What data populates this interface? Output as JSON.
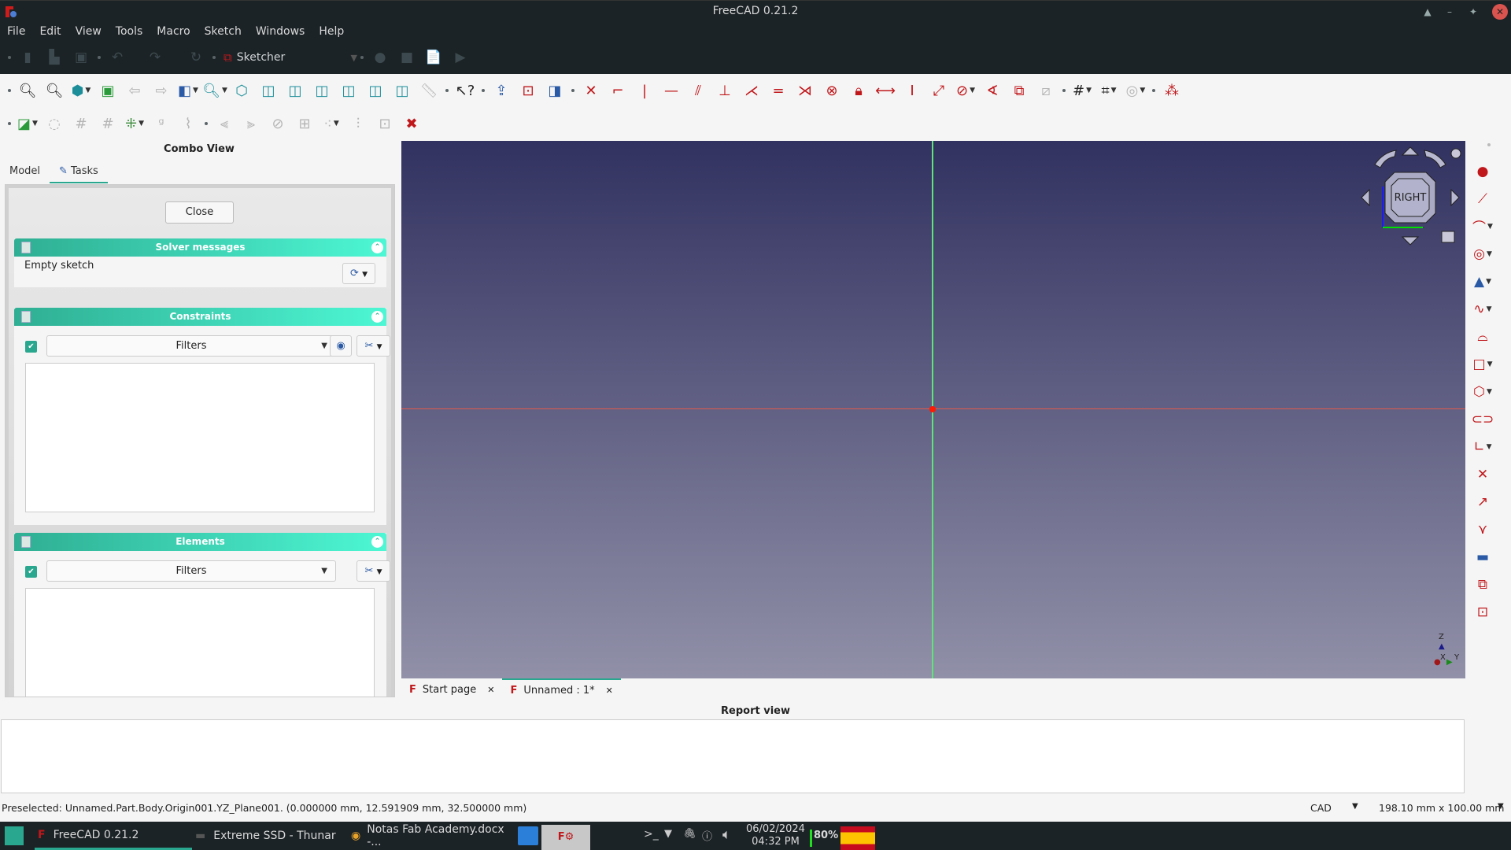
{
  "window": {
    "title": "FreeCAD 0.21.2",
    "controls": [
      "keep-above",
      "minimize",
      "maximize",
      "close"
    ]
  },
  "menu": [
    "File",
    "Edit",
    "View",
    "Tools",
    "Macro",
    "Sketch",
    "Windows",
    "Help"
  ],
  "workbench": {
    "selected": "Sketcher"
  },
  "toolbar_top": [
    "new-file",
    "open-file",
    "save",
    "undo",
    "redo",
    "refresh",
    "workbench-selector",
    "macro-record",
    "macro-stop",
    "macro-edit",
    "macro-run"
  ],
  "toolbar_view": [
    "std-view-fit-all",
    "std-view-fit-selection",
    "draw-style",
    "bounding-box",
    "back",
    "forward",
    "send-to-python",
    "zoom",
    "isometric",
    "front",
    "top",
    "right",
    "rear",
    "bottom",
    "left",
    "measure",
    "whats-this",
    "leave-sketch",
    "view-sketch",
    "view-section",
    "constrain-coincident",
    "constrain-point-on-object",
    "constrain-vertical",
    "constrain-horizontal",
    "constrain-parallel",
    "constrain-perpendicular",
    "constrain-tangent",
    "constrain-equal",
    "constrain-symmetric",
    "constrain-block",
    "constrain-lock",
    "constrain-horizontal-distance",
    "constrain-vertical-distance",
    "constrain-distance",
    "constrain-radius",
    "constrain-angle",
    "toggle-driving",
    "toggle-active",
    "grid",
    "snap",
    "rendering-order",
    "show-hide-internal-geometry"
  ],
  "toolbar_sketch": [
    "sketch-geometry",
    "close-shape",
    "connect",
    "select-constraints",
    "select-origin",
    "select-h-axis",
    "select-v-axis",
    "select-elements",
    "select-redundant",
    "select-conflicting",
    "symmetry",
    "clone",
    "copy",
    "move",
    "rectangular-array",
    "remove-axes-alignment",
    "delete-all-geometry"
  ],
  "combo_view": {
    "title": "Combo View",
    "tabs": [
      {
        "label": "Model",
        "active": false
      },
      {
        "label": "Tasks",
        "active": true
      }
    ],
    "close_button": "Close",
    "solver": {
      "title": "Solver messages",
      "message": "Empty sketch"
    },
    "constraints": {
      "title": "Constraints",
      "filter_checked": true,
      "filter_label": "Filters"
    },
    "elements": {
      "title": "Elements",
      "filter_checked": true,
      "filter_label": "Filters"
    }
  },
  "navcube": {
    "face": "RIGHT"
  },
  "axes": {
    "x": "X",
    "y": "Y",
    "z": "Z"
  },
  "doc_tabs": [
    {
      "label": "Start page",
      "active": false
    },
    {
      "label": "Unnamed : 1*",
      "active": true
    }
  ],
  "report_view": {
    "title": "Report view",
    "content": ""
  },
  "status": {
    "message": "Preselected: Unnamed.Part.Body.Origin001.YZ_Plane001. (0.000000 mm, 12.591909 mm, 32.500000 mm)",
    "navigation_style": "CAD",
    "dimensions": "198.10 mm x 100.00 mm"
  },
  "taskbar": {
    "items": [
      {
        "label": "FreeCAD 0.21.2",
        "active": true
      },
      {
        "label": "Extreme SSD - Thunar",
        "active": false
      },
      {
        "label": "Notas Fab Academy.docx -...",
        "active": false
      }
    ],
    "date": "06/02/2024",
    "time": "04:32 PM",
    "battery": "80%"
  },
  "colors": {
    "accent": "#2aa88f",
    "x_axis": "#e25a4a",
    "y_axis": "#5fe37a",
    "origin": "#ff1a00",
    "sketch_red": "#c0171b"
  }
}
